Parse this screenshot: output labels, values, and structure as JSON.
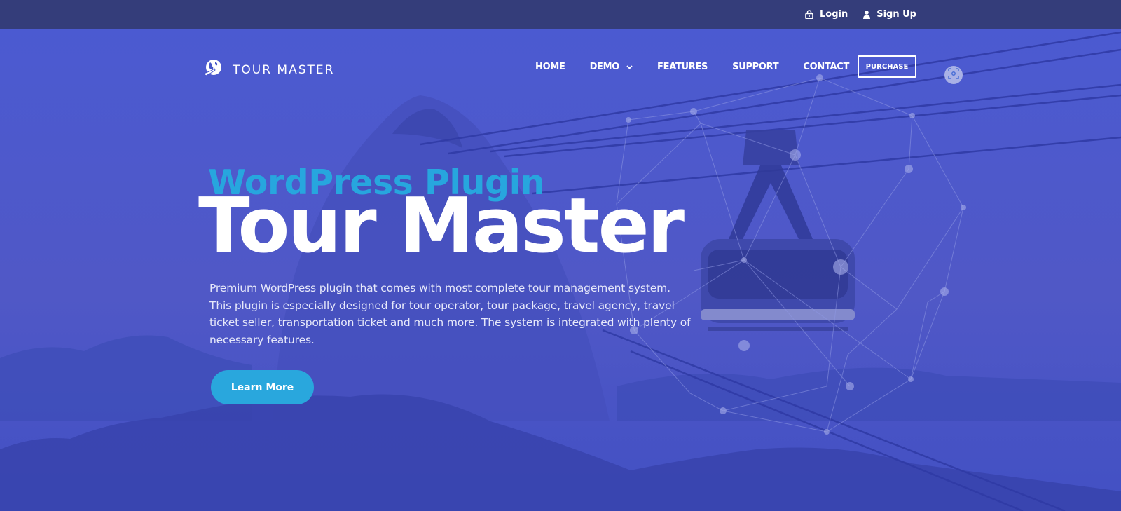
{
  "topbar": {
    "login": {
      "label": "Login",
      "icon": "lock-icon"
    },
    "signup": {
      "label": "Sign Up",
      "icon": "user-icon"
    }
  },
  "navbar": {
    "logo_text": "TOUR MASTER",
    "logo_icon": "globe-plane-icon",
    "menu": [
      {
        "label": "HOME"
      },
      {
        "label": "DEMO",
        "has_dropdown": true
      },
      {
        "label": "FEATURES"
      },
      {
        "label": "SUPPORT"
      },
      {
        "label": "CONTACT"
      }
    ],
    "purchase_label": "PURCHASE",
    "scan_icon": "screen-capture-icon"
  },
  "hero": {
    "subtitle": "WordPress Plugin",
    "title": "Tour Master",
    "description": "Premium WordPress plugin that comes with most complete tour management system. This plugin is especially designed for tour operator, tour package, travel agency, travel ticket seller, transportation ticket and much more. The system is integrated with plenty of necessary features.",
    "cta_label": "Learn More"
  },
  "colors": {
    "topbar_bg": "#343d7a",
    "hero_overlay": "#4655c9",
    "accent": "#27a6de",
    "text": "#ffffff"
  }
}
